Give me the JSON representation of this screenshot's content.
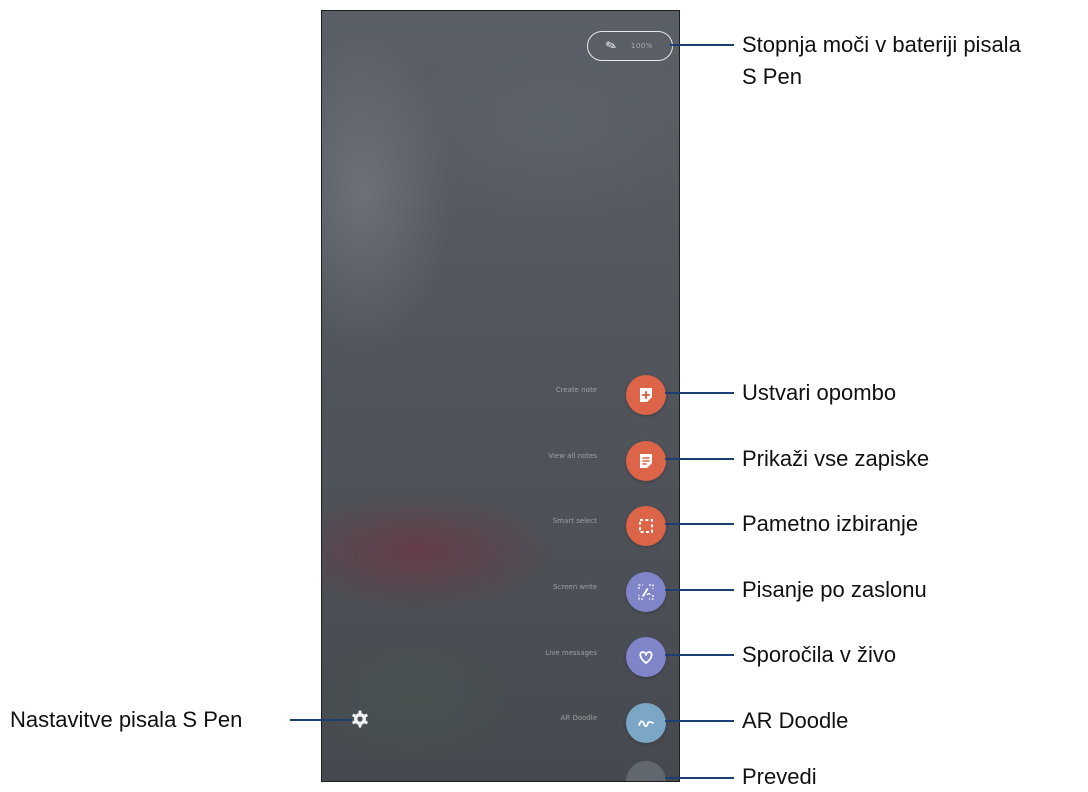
{
  "screen": {
    "battery": {
      "value": "100%",
      "icon": "pen-icon"
    },
    "commands": [
      {
        "label": "Create note",
        "icon": "create-note-icon",
        "color": "#dc6448"
      },
      {
        "label": "View all notes",
        "icon": "notes-icon",
        "color": "#dc6448"
      },
      {
        "label": "Smart select",
        "icon": "smart-select-icon",
        "color": "#dc6448"
      },
      {
        "label": "Screen write",
        "icon": "screen-write-icon",
        "color": "#7f85c8"
      },
      {
        "label": "Live messages",
        "icon": "heart-icon",
        "color": "#7f85c8"
      },
      {
        "label": "AR Doodle",
        "icon": "doodle-icon",
        "color": "#7ca6c6"
      }
    ],
    "settings_icon": "gear-icon"
  },
  "callouts": {
    "battery_line1": "Stopnja moči v bateriji pisala",
    "battery_line2": "S Pen",
    "create_note": "Ustvari opombo",
    "view_notes": "Prikaži vse zapiske",
    "smart_select": "Pametno izbiranje",
    "screen_write": "Pisanje po zaslonu",
    "live_messages": "Sporočila v živo",
    "ar_doodle": "AR Doodle",
    "translate": "Prevedi",
    "settings": "Nastavitve pisala S Pen"
  },
  "colors": {
    "leader": "#1b3f73",
    "accent_orange": "#dc6448",
    "accent_purple": "#7f85c8",
    "accent_blue": "#7ca6c6"
  }
}
